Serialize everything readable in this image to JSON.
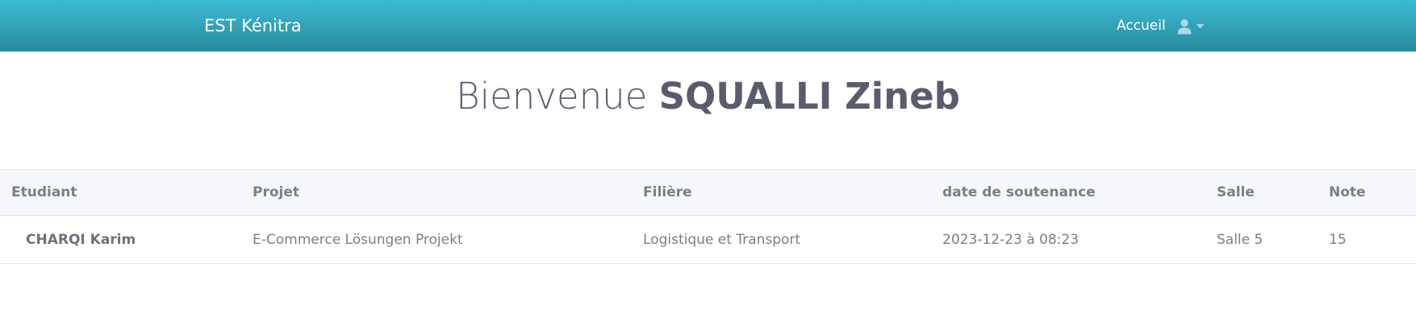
{
  "navbar": {
    "brand": "EST Kénitra",
    "home_link": "Accueil",
    "user_icon": "user-icon",
    "caret_icon": "caret-down-icon",
    "gradient_top": "#3bbbd3",
    "gradient_bottom": "#2a8a9d"
  },
  "welcome": {
    "greeting": "Bienvenue",
    "name": "SQUALLI Zineb"
  },
  "table": {
    "headers": {
      "student": "Etudiant",
      "project": "Projet",
      "field": "Filière",
      "defense_date": "date de soutenance",
      "room": "Salle",
      "grade": "Note"
    },
    "rows": [
      {
        "student": "CHARQI Karim",
        "project": "E-Commerce Lösungen Projekt",
        "field": "Logistique et Transport",
        "defense_date": "2023-12-23 à 08:23",
        "room": "Salle 5",
        "grade": "15"
      }
    ]
  }
}
